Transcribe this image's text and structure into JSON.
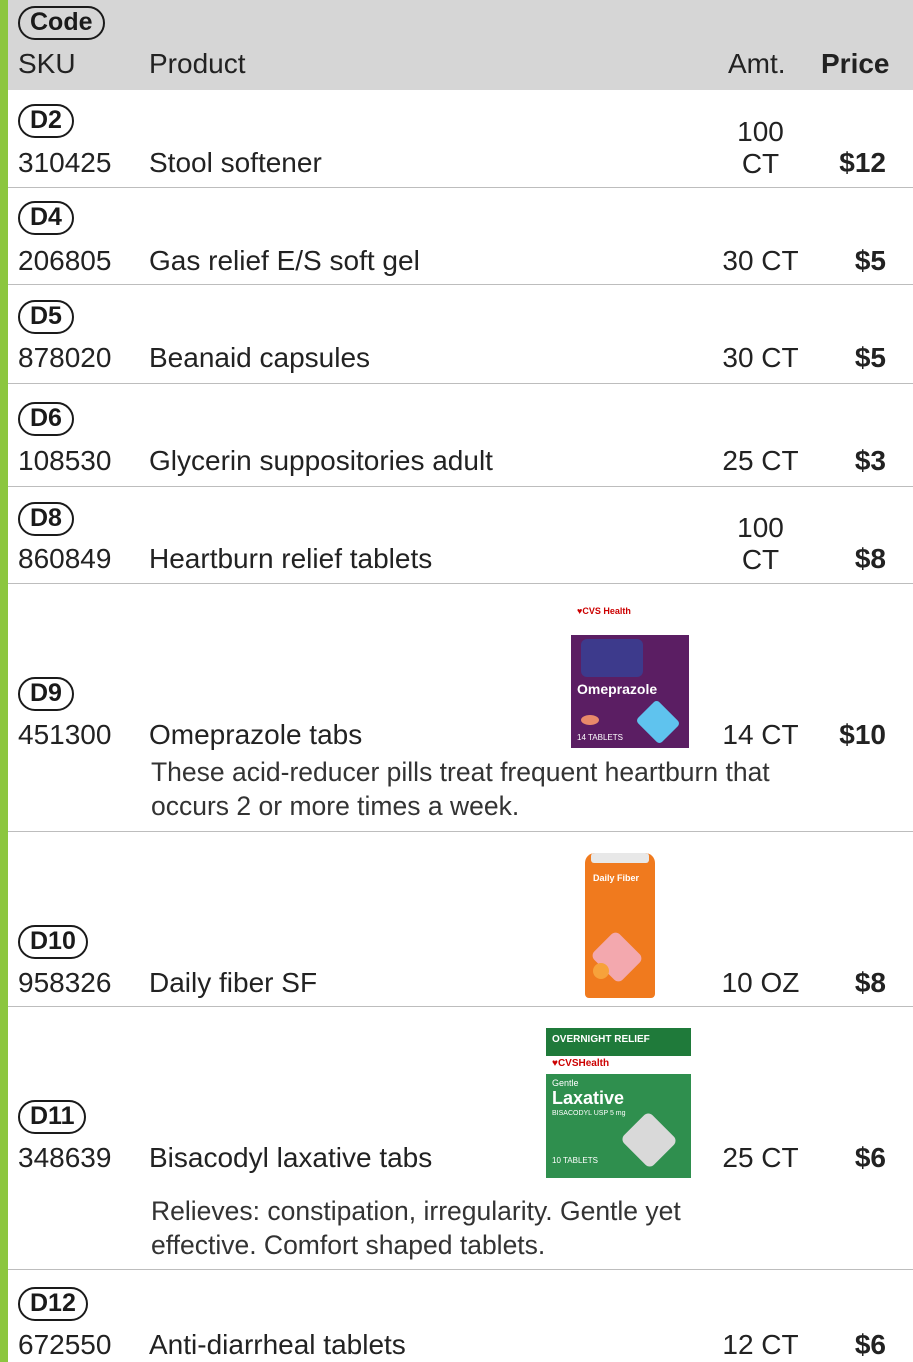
{
  "header": {
    "code_label": "Code",
    "sku_label": "SKU",
    "product_label": "Product",
    "amt_label": "Amt.",
    "price_label": "Price"
  },
  "rows": [
    {
      "code": "D2",
      "sku": "310425",
      "name": "Stool softener",
      "amt": "100\nCT",
      "price": "$12"
    },
    {
      "code": "D4",
      "sku": "206805",
      "name": "Gas relief E/S soft gel",
      "amt": "30 CT",
      "price": "$5"
    },
    {
      "code": "D5",
      "sku": "878020",
      "name": "Beanaid capsules",
      "amt": "30 CT",
      "price": "$5"
    },
    {
      "code": "D6",
      "sku": "108530",
      "name": "Glycerin suppositories adult",
      "amt": "25 CT",
      "price": "$3"
    },
    {
      "code": "D8",
      "sku": "860849",
      "name": "Heartburn relief tablets",
      "amt": "100\nCT",
      "price": "$8"
    },
    {
      "code": "D9",
      "sku": "451300",
      "name": "Omeprazole tabs",
      "amt": "14 CT",
      "price": "$10",
      "desc": "These acid-reducer pills treat frequent heartburn that occurs 2 or more times a week."
    },
    {
      "code": "D10",
      "sku": "958326",
      "name": "Daily fiber SF",
      "amt": "10 OZ",
      "price": "$8"
    },
    {
      "code": "D11",
      "sku": "348639",
      "name": "Bisacodyl laxative tabs",
      "amt": "25 CT",
      "price": "$6",
      "desc": "Relieves: constipation, irregularity. Gentle yet effective. Comfort shaped tablets."
    },
    {
      "code": "D12",
      "sku": "672550",
      "name": "Anti-diarrheal tablets",
      "amt": "12 CT",
      "price": "$6"
    }
  ],
  "images": {
    "omeprazole": {
      "brand": "♥CVS Health",
      "title": "Omeprazole",
      "count": "14 TABLETS",
      "color": "#5b1e63"
    },
    "fiber": {
      "title": "Daily Fiber",
      "color": "#f07a1e"
    },
    "laxative": {
      "banner": "OVERNIGHT RELIEF",
      "brand": "♥CVSHealth",
      "sub": "Gentle",
      "title": "Laxative",
      "detail": "BISACODYL USP 5 mg",
      "count": "10 TABLETS",
      "color": "#2f8f4e"
    }
  },
  "colors": {
    "accent_green": "#8cc63f",
    "header_gray": "#d6d6d6"
  }
}
